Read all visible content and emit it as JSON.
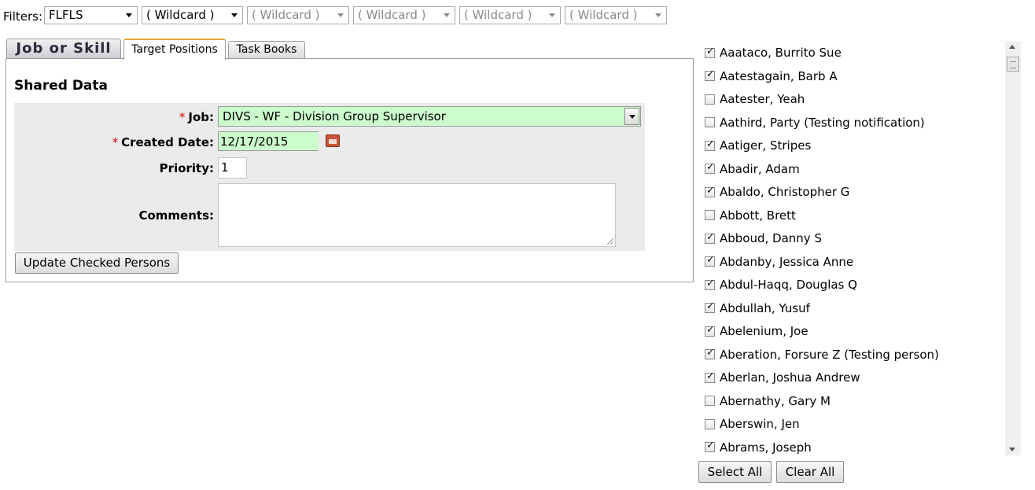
{
  "filters": {
    "label": "Filters:",
    "selects": [
      "FLFLS",
      "( Wildcard )",
      "( Wildcard )",
      "( Wildcard )",
      "( Wildcard )",
      "( Wildcard )"
    ]
  },
  "tabs": {
    "job_or_skill": "Job or Skill",
    "target_positions": "Target Positions",
    "task_books": "Task Books"
  },
  "panel": {
    "title": "Shared Data",
    "required_mark": "*",
    "job_label": "Job:",
    "job_value": "DIVS - WF - Division Group Supervisor",
    "created_date_label": "Created Date:",
    "created_date_value": "12/17/2015",
    "priority_label": "Priority:",
    "priority_value": "1",
    "comments_label": "Comments:",
    "comments_value": "",
    "update_button": "Update Checked Persons"
  },
  "persons": [
    {
      "name": "Aaataco, Burrito Sue",
      "checked": true
    },
    {
      "name": "Aatestagain, Barb A",
      "checked": true
    },
    {
      "name": "Aatester, Yeah",
      "checked": false
    },
    {
      "name": "Aathird, Party (Testing notification)",
      "checked": false
    },
    {
      "name": "Aatiger, Stripes",
      "checked": true
    },
    {
      "name": "Abadir, Adam",
      "checked": true
    },
    {
      "name": "Abaldo, Christopher G",
      "checked": true
    },
    {
      "name": "Abbott, Brett",
      "checked": false
    },
    {
      "name": "Abboud, Danny S",
      "checked": true
    },
    {
      "name": "Abdanby, Jessica Anne",
      "checked": true
    },
    {
      "name": "Abdul-Haqq, Douglas Q",
      "checked": true
    },
    {
      "name": "Abdullah, Yusuf",
      "checked": true
    },
    {
      "name": "Abelenium, Joe",
      "checked": true
    },
    {
      "name": "Aberation, Forsure Z (Testing person)",
      "checked": true
    },
    {
      "name": "Aberlan, Joshua Andrew",
      "checked": true
    },
    {
      "name": "Abernathy, Gary M",
      "checked": false
    },
    {
      "name": "Aberswin, Jen",
      "checked": false
    },
    {
      "name": "Abrams, Joseph",
      "checked": true
    }
  ],
  "buttons": {
    "select_all": "Select All",
    "clear_all": "Clear All"
  }
}
